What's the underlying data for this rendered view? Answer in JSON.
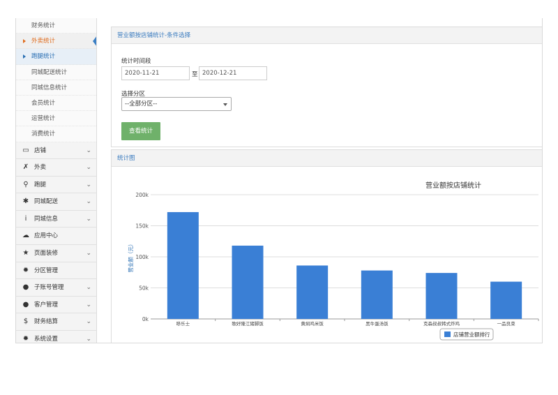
{
  "sidebar": {
    "sub_items": [
      {
        "label": "财务统计",
        "state": "normal"
      },
      {
        "label": "外卖统计",
        "state": "active"
      },
      {
        "label": "跑腿统计",
        "state": "selected"
      },
      {
        "label": "同城配送统计",
        "state": "normal"
      },
      {
        "label": "同城信息统计",
        "state": "normal"
      },
      {
        "label": "会员统计",
        "state": "normal"
      },
      {
        "label": "运营统计",
        "state": "normal"
      },
      {
        "label": "消费统计",
        "state": "normal"
      }
    ],
    "nav_items": [
      {
        "label": "店铺",
        "icon": "monitor-icon",
        "glyph": "▭",
        "chevron": true
      },
      {
        "label": "外卖",
        "icon": "utensils-icon",
        "glyph": "✗",
        "chevron": true
      },
      {
        "label": "跑腿",
        "icon": "bicycle-icon",
        "glyph": "⚲",
        "chevron": true
      },
      {
        "label": "同城配送",
        "icon": "asterisk-icon",
        "glyph": "✱",
        "chevron": true
      },
      {
        "label": "同城信息",
        "icon": "info-icon",
        "glyph": "i",
        "chevron": true
      },
      {
        "label": "应用中心",
        "icon": "cloud-icon",
        "glyph": "☁",
        "chevron": false
      },
      {
        "label": "页面装修",
        "icon": "star-icon",
        "glyph": "★",
        "chevron": true
      },
      {
        "label": "分区管理",
        "icon": "gear-icon",
        "glyph": "✹",
        "chevron": false
      },
      {
        "label": "子账号管理",
        "icon": "user-icon",
        "glyph": "●",
        "chevron": true
      },
      {
        "label": "客户管理",
        "icon": "users-icon",
        "glyph": "●",
        "chevron": true
      },
      {
        "label": "财务结算",
        "icon": "dollar-icon",
        "glyph": "$",
        "chevron": true
      },
      {
        "label": "系统设置",
        "icon": "cog-icon",
        "glyph": "✹",
        "chevron": true
      }
    ]
  },
  "filter": {
    "title": "营业额按店铺统计-条件选择",
    "period_label": "统计时间段",
    "start_date": "2020-11-21",
    "to_label": "至",
    "end_date": "2020-12-21",
    "zone_label": "选择分区",
    "zone_selected": "--全部分区--",
    "submit_label": "查看统计"
  },
  "chart_panel": {
    "title": "统计图"
  },
  "colors": {
    "bar": "#3a7fd5",
    "accent": "#3a7bbf",
    "button": "#6fb16a"
  },
  "chart_data": {
    "type": "bar",
    "title": "营业额按店铺统计",
    "ylabel": "营业额（元）",
    "xlabel": "",
    "categories": [
      "哆乐士",
      "歌好隆江猪脚饭",
      "黄焖鸡米饭",
      "黑牛蛋汤饭",
      "克森叔叔韩式炸鸡",
      "一品良菜"
    ],
    "series": [
      {
        "name": "店铺营业额排行",
        "values": [
          172000,
          118000,
          86000,
          78000,
          74000,
          60000
        ]
      }
    ],
    "ylim": [
      0,
      200000
    ],
    "yticks": [
      {
        "value": 0,
        "label": "0k"
      },
      {
        "value": 50000,
        "label": "50k"
      },
      {
        "value": 100000,
        "label": "100k"
      },
      {
        "value": 150000,
        "label": "150k"
      },
      {
        "value": 200000,
        "label": "200k"
      }
    ],
    "grid": true,
    "legend": "bottom-right"
  }
}
